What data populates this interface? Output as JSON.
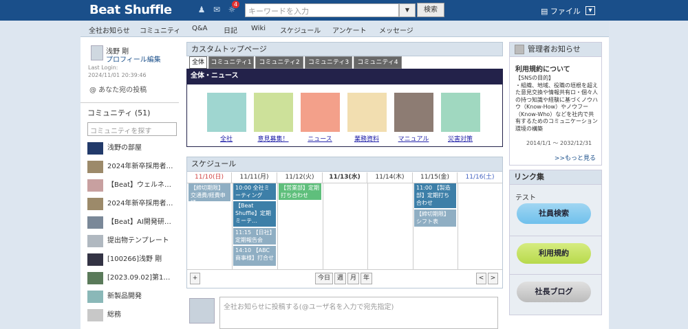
{
  "header": {
    "logo": "Beat Shuffle",
    "badge": "4",
    "search_placeholder": "キーワードを入力",
    "search_button": "検索",
    "file_label": "ファイル"
  },
  "nav": [
    "全社お知らせ",
    "コミュニティ",
    "Q&A",
    "日記",
    "Wiki",
    "スケジュール",
    "アンケート",
    "メッセージ"
  ],
  "profile": {
    "name": "浅野 剛",
    "edit": "プロフィール編集",
    "last_login": "Last Login:",
    "last_login_time": "2024/11/01 20:39:46",
    "mentions": "@ あなた宛の投稿"
  },
  "community": {
    "title": "コミュニティ (51)",
    "search_placeholder": "コミュニティを探す",
    "items": [
      "浅野の部屋",
      "2024年新卒採用者…",
      "【Beat】ウェルネ…",
      "2024年新卒採用者…",
      "【Beat】AI開発研…",
      "提出物テンプレート",
      "[100266]浅野 剛",
      "[2023.09.02]第1…",
      "新製品開発",
      "総務"
    ]
  },
  "custom_top": {
    "title": "カスタムトップページ",
    "tabs": [
      "全体",
      "コミュニティ1",
      "コミュニティ2",
      "コミュニティ3",
      "コミュニティ4"
    ],
    "news_bar": "全体・ニュース",
    "icons": [
      "全社",
      "意見募集！",
      "ニュース",
      "業務資料",
      "マニュアル",
      "災害対策"
    ]
  },
  "schedule": {
    "title": "スケジュール",
    "days": [
      "11/10(日)",
      "11/11(月)",
      "11/12(火)",
      "11/13(水)",
      "11/14(木)",
      "11/15(金)",
      "11/16(土)"
    ],
    "events": {
      "sun": "【締切期限】交通費/経費申請",
      "mon1": "10:00 全社ミーティング",
      "mon2": "【Beat Shuffle】定期ミーテ…",
      "mon3": "11:15 【日社】定期報告会",
      "mon4": "14:10 【ABC商事様】打合せ",
      "tue": "【営業部】定期打ち合わせ",
      "fri1": "11:00 【製造部】定期打ち合わせ",
      "fri2": "【締切期限】シフト表"
    },
    "plus": "+",
    "today": "今日",
    "week": "週",
    "month": "月",
    "year": "年",
    "prev": "<",
    "next": ">"
  },
  "post": {
    "placeholder": "全社お知らせに投稿する(@ユーザ名を入力で宛先指定)"
  },
  "admin": {
    "title": "管理者お知らせ",
    "heading": "利用規約について",
    "body": "【SNSの目的】\n・組織、地域、役職の垣根を超えた意見交換や情報共有ロ・個々人の持つ知識や経験に基づくノウハウ（Know-How）やノウフー（Know-Who）などを社内で共有するためのコミュニケーション環境の構築",
    "date": "2014/1/1 〜 2032/12/31",
    "more": ">>もっと見る"
  },
  "links": {
    "title": "リンク集",
    "test": "テスト",
    "employee_search": "社員検索",
    "terms": "利用規約",
    "blog": "社長ブログ"
  }
}
